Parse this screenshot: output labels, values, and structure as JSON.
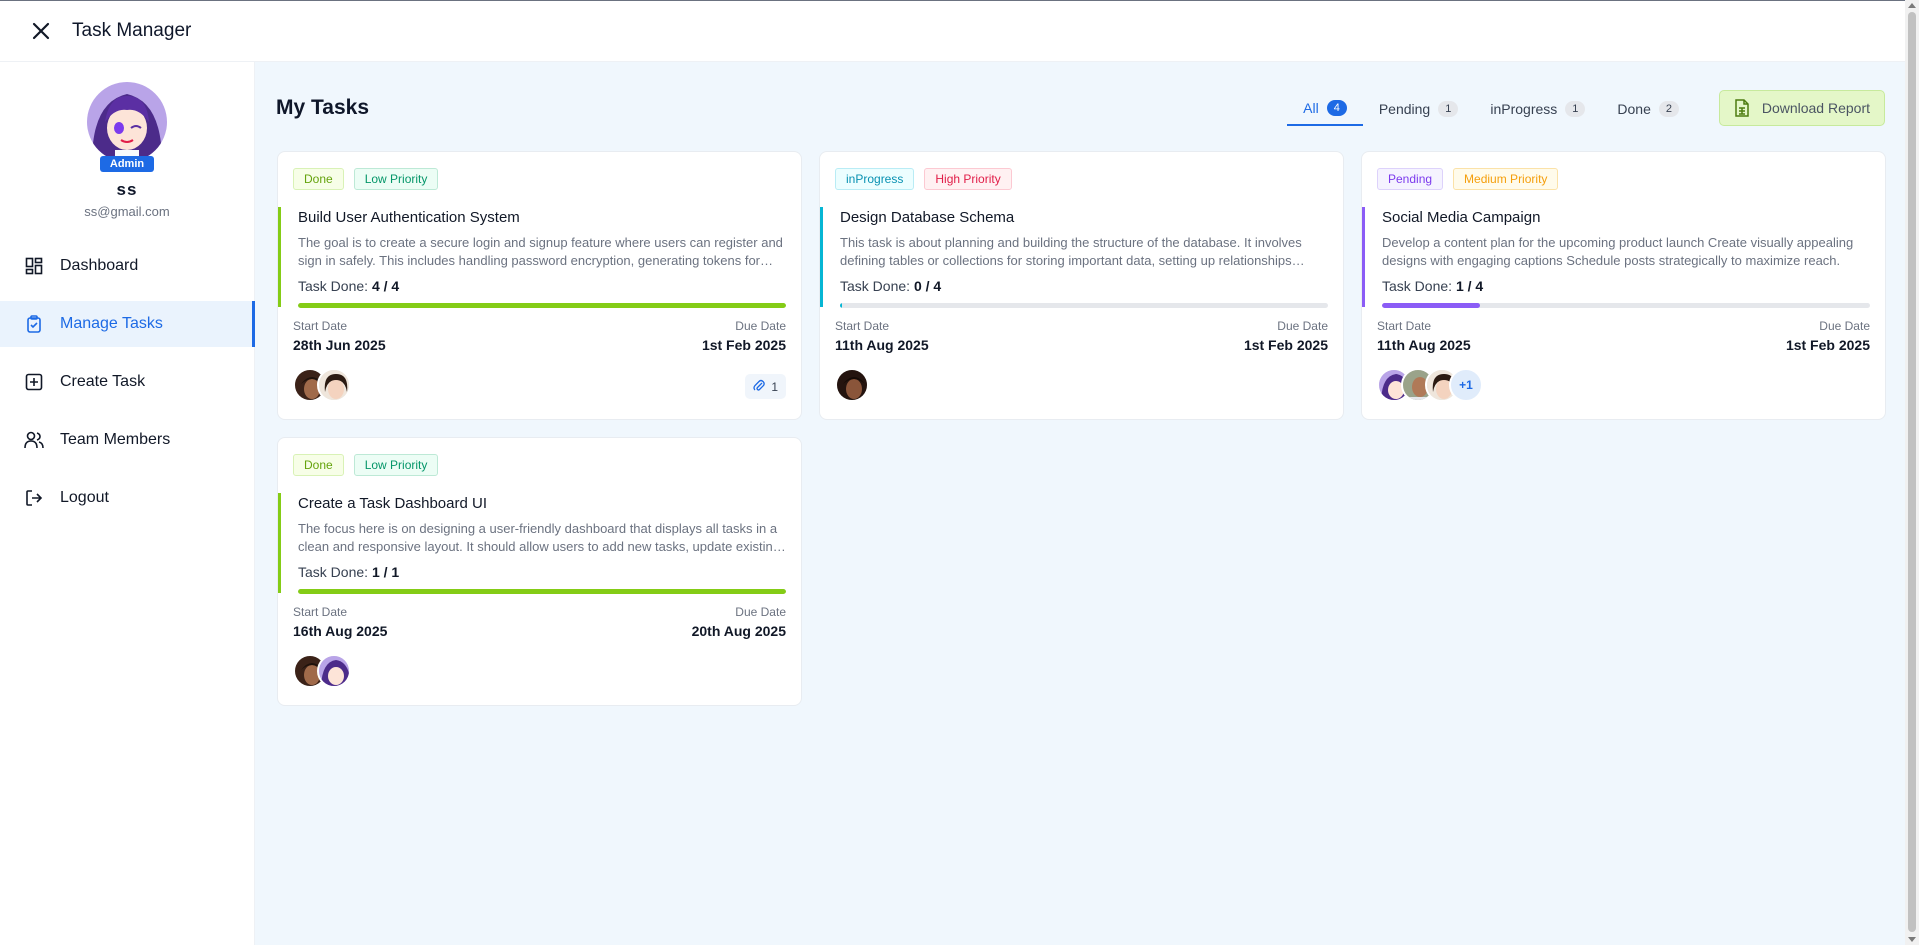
{
  "app": {
    "title": "Task Manager"
  },
  "user": {
    "role": "Admin",
    "name": "ss",
    "email": "ss@gmail.com"
  },
  "sidebar": {
    "items": [
      {
        "label": "Dashboard",
        "icon": "dashboard-icon"
      },
      {
        "label": "Manage Tasks",
        "icon": "clipboard-check-icon",
        "active": true
      },
      {
        "label": "Create Task",
        "icon": "plus-square-icon"
      },
      {
        "label": "Team Members",
        "icon": "users-icon"
      },
      {
        "label": "Logout",
        "icon": "logout-icon"
      }
    ]
  },
  "main": {
    "title": "My Tasks",
    "tabs": [
      {
        "label": "All",
        "count": "4",
        "active": true
      },
      {
        "label": "Pending",
        "count": "1"
      },
      {
        "label": "inProgress",
        "count": "1"
      },
      {
        "label": "Done",
        "count": "2"
      }
    ],
    "download_label": "Download Report",
    "labels": {
      "start": "Start Date",
      "due": "Due Date",
      "task_done": "Task Done:"
    }
  },
  "tasks": [
    {
      "status": "Done",
      "priority": "Low Priority",
      "title": "Build User Authentication System",
      "description": "The goal is to create a secure login and signup feature where users can register and sign in safely. This includes handling password encryption, generating tokens for sessions, and protecting routes.",
      "progress_text": "4 / 4",
      "progress": 1.0,
      "start": "28th Jun 2025",
      "due": "1st Feb 2025",
      "attachments": "1",
      "accent": "#84cc16"
    },
    {
      "status": "inProgress",
      "priority": "High Priority",
      "title": "Design Database Schema",
      "description": "This task is about planning and building the structure of the database. It involves defining tables or collections for storing important data, setting up relationships between them.",
      "progress_text": "0 / 4",
      "progress": 0.0,
      "start": "11th Aug 2025",
      "due": "1st Feb 2025",
      "accent": "#06b6d4"
    },
    {
      "status": "Pending",
      "priority": "Medium Priority",
      "title": "Social Media Campaign",
      "description": "Develop a content plan for the upcoming product launch Create visually appealing designs with engaging captions Schedule posts strategically to maximize reach.",
      "progress_text": "1 / 4",
      "progress": 0.2,
      "start": "11th Aug 2025",
      "due": "1st Feb 2025",
      "more_assignees": "+1",
      "accent": "#8b5cf6"
    },
    {
      "status": "Done",
      "priority": "Low Priority",
      "title": "Create a Task Dashboard UI",
      "description": "The focus here is on designing a user-friendly dashboard that displays all tasks in a clean and responsive layout. It should allow users to add new tasks, update existing ones.",
      "progress_text": "1 / 1",
      "progress": 1.0,
      "start": "16th Aug 2025",
      "due": "20th Aug 2025",
      "accent": "#84cc16"
    }
  ]
}
